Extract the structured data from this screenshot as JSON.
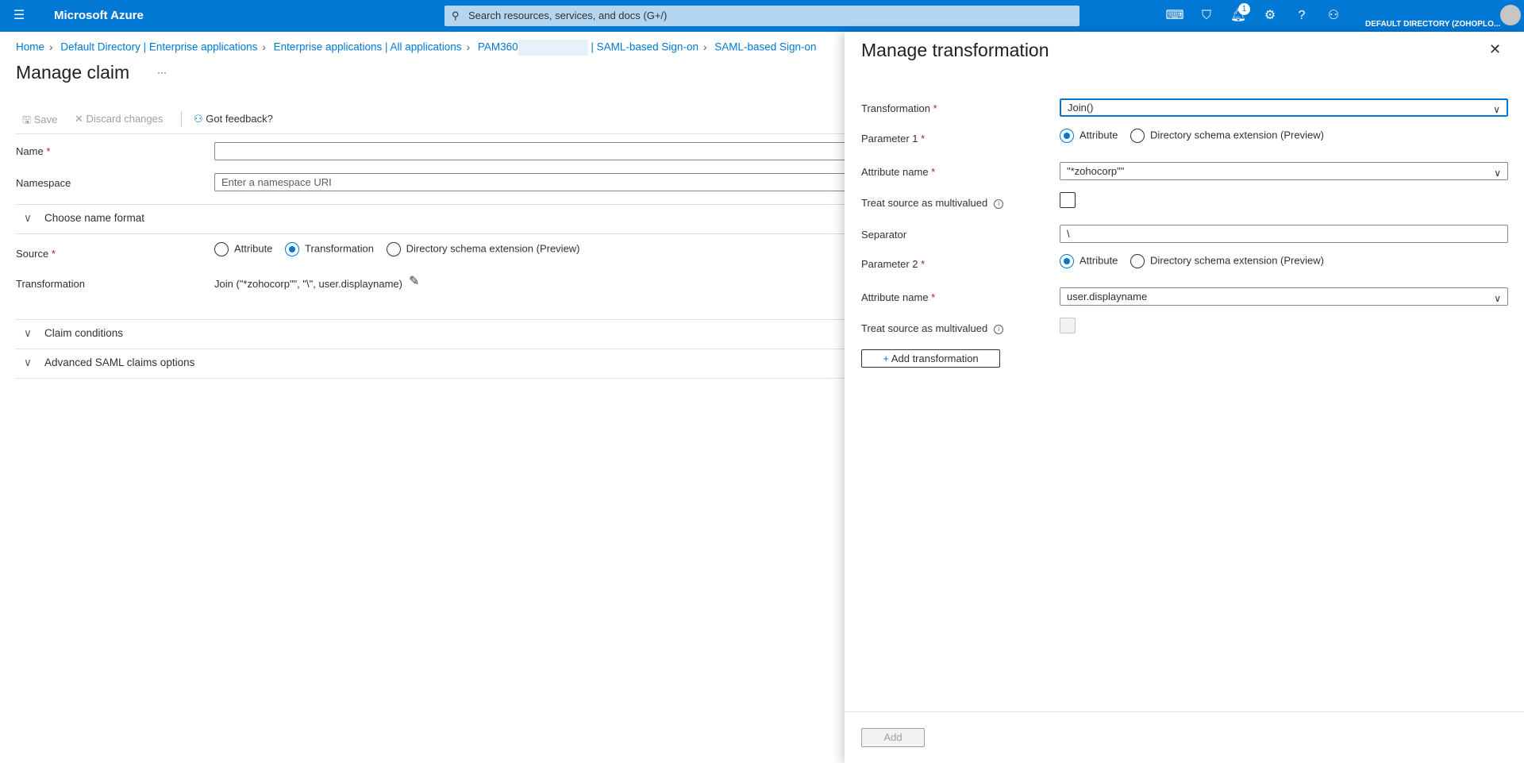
{
  "topbar": {
    "brand": "Microsoft Azure",
    "search_placeholder": "Search resources, services, and docs (G+/)",
    "notification_count": "1",
    "directory": "DEFAULT DIRECTORY (ZOHOPLO..."
  },
  "breadcrumb": [
    "Home",
    "Default Directory | Enterprise applications",
    "Enterprise applications | All applications",
    "PAM360",
    "| SAML-based Sign-on",
    "SAML-based Sign-on"
  ],
  "page": {
    "title": "Manage claim",
    "more": "···"
  },
  "toolbar": {
    "save": "Save",
    "discard": "Discard changes",
    "feedback": "Got feedback?"
  },
  "form": {
    "name_label": "Name",
    "name_value": "",
    "namespace_label": "Namespace",
    "namespace_placeholder": "Enter a namespace URI",
    "choose_name_format": "Choose name format",
    "source_label": "Source",
    "source_options": [
      "Attribute",
      "Transformation",
      "Directory schema extension (Preview)"
    ],
    "source_selected": "Transformation",
    "transformation_label": "Transformation",
    "transformation_value": "Join (\"*zohocorp\"\", \"\\\", user.displayname)",
    "claim_conditions": "Claim conditions",
    "advanced": "Advanced SAML claims options"
  },
  "panel": {
    "title": "Manage transformation",
    "transformation_label": "Transformation",
    "transformation_value": "Join()",
    "param1_label": "Parameter 1",
    "param_options": [
      "Attribute",
      "Directory schema extension (Preview)"
    ],
    "attr_name_label": "Attribute name",
    "attr1_value": "\"*zohocorp\"\"",
    "multivalued_label": "Treat source as multivalued",
    "separator_label": "Separator",
    "separator_value": "\\",
    "param2_label": "Parameter 2",
    "attr2_value": "user.displayname",
    "add_transformation": "Add transformation",
    "add": "Add"
  },
  "required_mark": "*"
}
